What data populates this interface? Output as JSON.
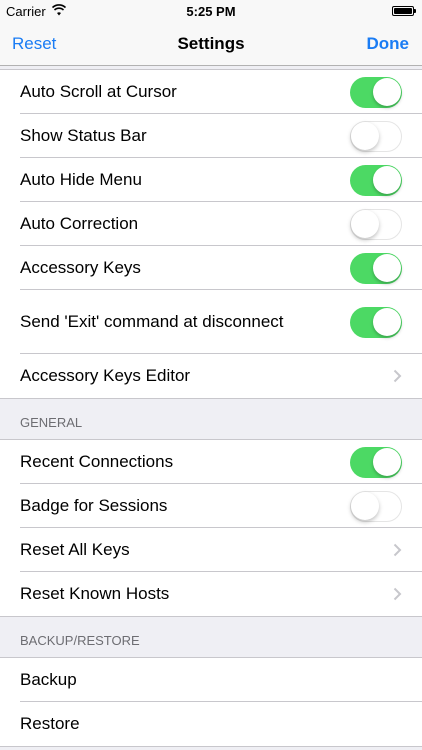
{
  "status_bar": {
    "carrier": "Carrier",
    "time": "5:25 PM"
  },
  "nav": {
    "left_label": "Reset",
    "title": "Settings",
    "right_label": "Done"
  },
  "groups": [
    {
      "header": "",
      "rows": [
        {
          "label": "Auto Scroll at Cursor",
          "control": "switch",
          "on": true
        },
        {
          "label": "Show Status Bar",
          "control": "switch",
          "on": false
        },
        {
          "label": "Auto Hide Menu",
          "control": "switch",
          "on": true
        },
        {
          "label": "Auto Correction",
          "control": "switch",
          "on": false
        },
        {
          "label": "Accessory Keys",
          "control": "switch",
          "on": true
        },
        {
          "label": "Send 'Exit' command at disconnect",
          "control": "switch",
          "on": true
        },
        {
          "label": "Accessory Keys Editor",
          "control": "chevron"
        }
      ]
    },
    {
      "header": "GENERAL",
      "rows": [
        {
          "label": "Recent Connections",
          "control": "switch",
          "on": true
        },
        {
          "label": "Badge for Sessions",
          "control": "switch",
          "on": false
        },
        {
          "label": "Reset All Keys",
          "control": "chevron"
        },
        {
          "label": "Reset Known Hosts",
          "control": "chevron"
        }
      ]
    },
    {
      "header": "BACKUP/RESTORE",
      "rows": [
        {
          "label": "Backup",
          "control": "none"
        },
        {
          "label": "Restore",
          "control": "none"
        }
      ]
    }
  ],
  "colors": {
    "accent": "#1a7cf4",
    "switch_on": "#4cd964"
  }
}
